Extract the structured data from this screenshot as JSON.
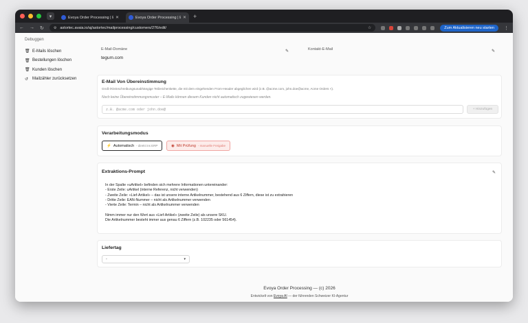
{
  "browser": {
    "tabs": [
      {
        "title": "Evoya Order Processing | Evo"
      },
      {
        "title": "Evoya Order Processing | Evo"
      }
    ],
    "url": "astortec.avaia.io/aj/astortec/mailprocessing/customers/276/edit/",
    "update_button": "Zum Aktualisieren neu starten",
    "colors": {
      "close": "#ff5f57",
      "minimize": "#febc2e",
      "maximize": "#28c840",
      "accent": "#1e64c8"
    }
  },
  "sidebar": {
    "title": "Debuggen",
    "items": [
      {
        "label": "E-Mails löschen",
        "icon": "trash-icon"
      },
      {
        "label": "Bestellungen löschen",
        "icon": "trash-icon"
      },
      {
        "label": "Kunden löschen",
        "icon": "trash-icon"
      },
      {
        "label": "Mailzähler zurücksetzen",
        "icon": "reset-icon"
      }
    ]
  },
  "fields": {
    "domain_label": "E-Mail-Domäne",
    "domain_value": "tegum.com",
    "contact_label": "Kontakt-E-Mail",
    "contact_value": ""
  },
  "match": {
    "title": "E-Mail Von Übereinstimmung",
    "description": "Groß-/Kleinschreibungsunabhängige Teilzeichenkette, die mit dem eingehenden From-Header abgeglichen wird (z.B. @acme.com, john.doe@acme, Acme Orders <).",
    "note": "Noch keine Übereinstimmungsmuster – E-Mails können diesem Kunden nicht automatisch zugewiesen werden.",
    "input_placeholder": "z.B. @acme.com oder john.doe@",
    "add_button": "+ Hinzufügen"
  },
  "processing": {
    "title": "Verarbeitungsmodus",
    "auto_label": "Automatisch",
    "auto_sub": "- direkt ins ERP",
    "check_label": "Mit Prüfung",
    "check_sub": "- manuelle Freigabe"
  },
  "prompt": {
    "title": "Extraktions-Prompt",
    "lines": [
      "In der Spalte «uArtikel» befinden sich mehrere Informationen untereinander:",
      "- Erste Zeile: uArtikel (interne Referenz, nicht verwenden)",
      "- Zweite Zeile: «Lief-Artikel» – das ist unsere interne Artikelnummer, bestehend aus 6 Ziffern, diese ist zu extrahieren",
      "- Dritte Zeile: EAN-Nummer – nicht als Artikelnummer verwenden",
      "- Vierte Zeile: Termin – nicht als Artikelnummer verwenden",
      "",
      "Nimm immer nur den Wert aus «Lief-Artikel» (zweite Zeile) als unsere SKU.",
      "Die Artikelnummer besteht immer aus genau 6 Ziffern (z.B. 102235 oder 561454)."
    ]
  },
  "delivery": {
    "title": "Liefertag",
    "selected": "-"
  },
  "footer": {
    "line1": "Evoya Order Processing — (c) 2026",
    "line2_prefix": "Entwickelt von ",
    "line2_link": "Evoya AI",
    "line2_suffix": " — der führenden Schweizer KI-Agentur"
  }
}
